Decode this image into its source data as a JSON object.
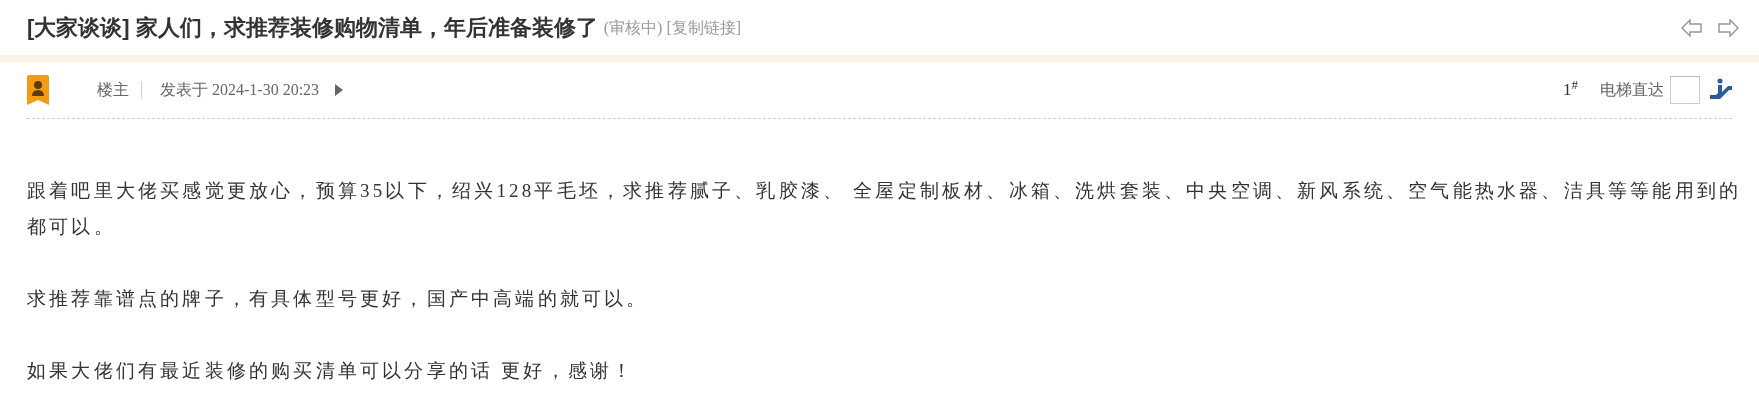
{
  "thread": {
    "title": "[大家谈谈] 家人们，求推荐装修购物清单，年后准备装修了",
    "status": "(审核中)",
    "copy_link": "[复制链接]"
  },
  "post": {
    "author": "楼主",
    "posted": "发表于 2024-1-30 20:23",
    "floor": "1",
    "floor_mark": "#",
    "jump": {
      "label": "电梯直达"
    }
  },
  "paragraphs": [
    "跟着吧里大佬买感觉更放心，预算35以下，绍兴128平毛坯，求推荐腻子、乳胶漆、 全屋定制板材、冰箱、洗烘套装、中央空调、新风系统、空气能热水器、洁具等等能用到的都可以。",
    "求推荐靠谱点的牌子，有具体型号更好，国产中高端的就可以。",
    "如果大佬们有最近装修的购买清单可以分享的话 更好，感谢！"
  ]
}
